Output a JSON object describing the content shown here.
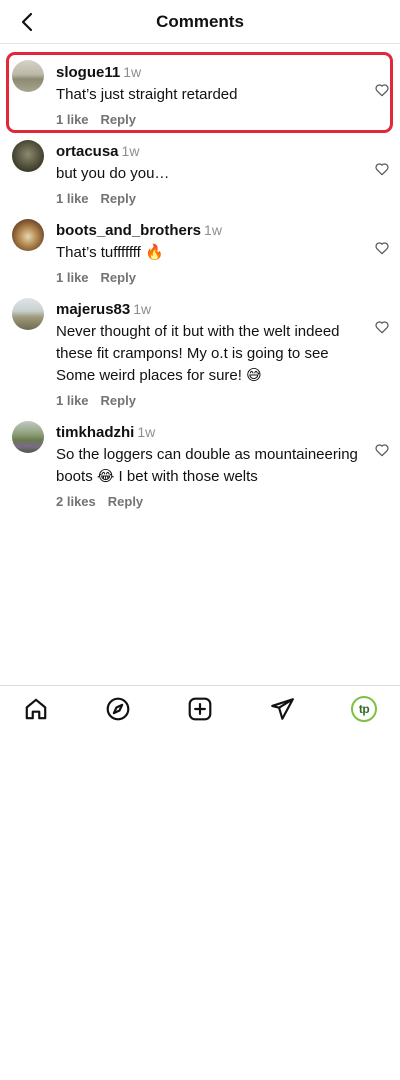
{
  "header": {
    "title": "Comments"
  },
  "comments": [
    {
      "username": "slogue11",
      "time": "1w",
      "text": "That’s just straight retarded",
      "likes": "1 like",
      "reply": "Reply"
    },
    {
      "username": "ortacusa",
      "time": "1w",
      "text": "but you do you…",
      "likes": "1 like",
      "reply": "Reply"
    },
    {
      "username": "boots_and_brothers",
      "time": "1w",
      "text": "That’s tufffffff 🔥",
      "likes": "1 like",
      "reply": "Reply"
    },
    {
      "username": "majerus83",
      "time": "1w",
      "text": "Never thought of it but with the welt indeed these fit crampons! My o.t is going to see Some weird places for sure! 😅",
      "likes": "1 like",
      "reply": "Reply"
    },
    {
      "username": "timkhadzhi",
      "time": "1w",
      "text": "So the loggers can double as mountaineering boots 😂 I bet with those welts",
      "likes": "2 likes",
      "reply": "Reply"
    }
  ],
  "nav": {
    "profile_initials": "tp"
  },
  "colors": {
    "highlight": "#e0283a",
    "profile_accent": "#7cc242"
  }
}
